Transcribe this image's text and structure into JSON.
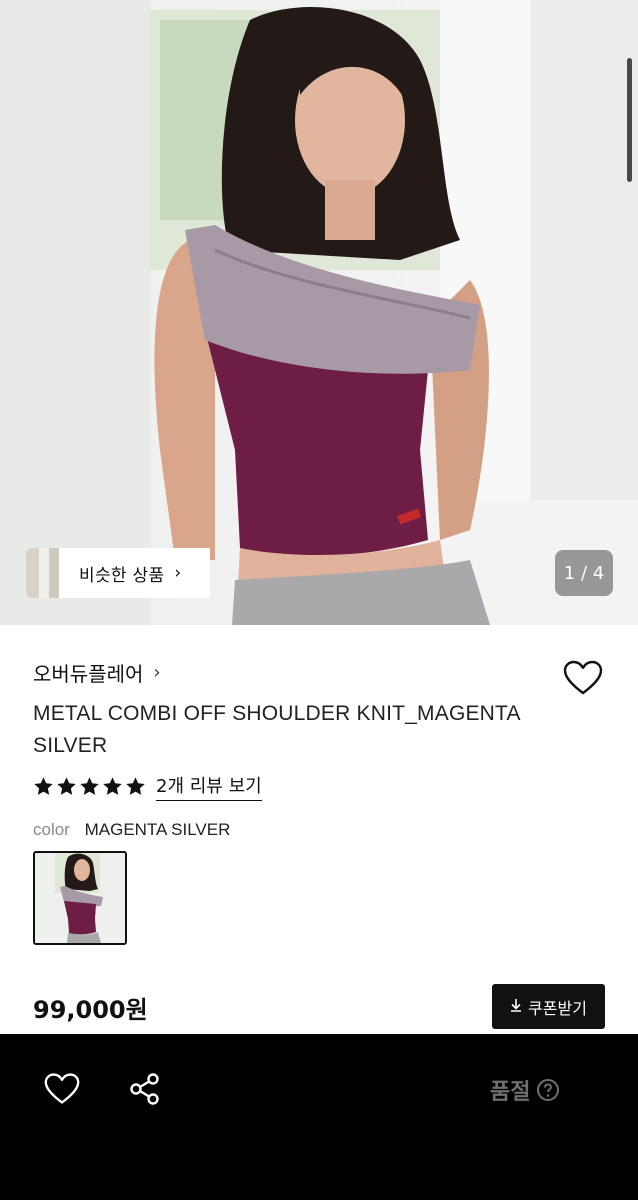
{
  "hero": {
    "similar_products_label": "비슷한 상품",
    "page_counter": "1 / 4"
  },
  "product": {
    "brand": "오버듀플레어",
    "title": "METAL COMBI OFF SHOULDER KNIT_MAGENTA SILVER",
    "rating_stars": 5,
    "review_link": "2개 리뷰 보기",
    "color_label": "color",
    "color_value": "MAGENTA SILVER",
    "price": "99,000원"
  },
  "actions": {
    "coupon_label": "쿠폰받기",
    "status_label": "품절"
  },
  "icons": {
    "wish_top": "heart-outline-icon",
    "bottom_wish": "heart-outline-icon",
    "share": "share-icon",
    "help": "question-circle-icon",
    "download": "download-icon"
  },
  "colors": {
    "accent": "#111111",
    "bottom_bar": "#000000",
    "garment_magenta": "#6e1e44",
    "garment_silver": "#a79aa6"
  }
}
